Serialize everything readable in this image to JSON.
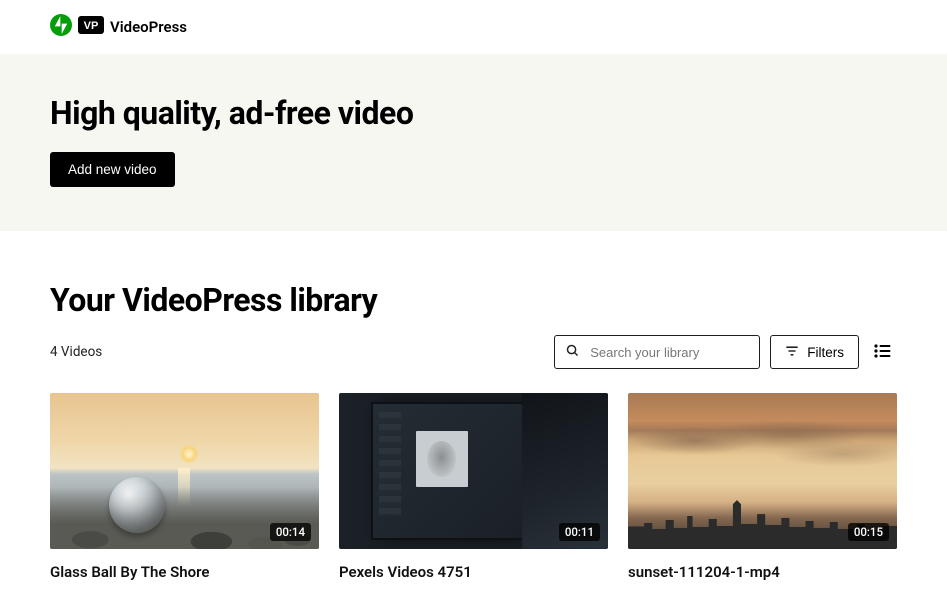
{
  "brand": {
    "name": "VideoPress"
  },
  "hero": {
    "headline": "High quality, ad-free video",
    "add_button": "Add new video"
  },
  "library": {
    "heading": "Your VideoPress library",
    "count_text": "4 Videos",
    "search_placeholder": "Search your library",
    "filters_label": "Filters",
    "videos": [
      {
        "title": "Glass Ball By The Shore",
        "duration": "00:14"
      },
      {
        "title": "Pexels Videos 4751",
        "duration": "00:11"
      },
      {
        "title": "sunset-111204-1-mp4",
        "duration": "00:15"
      }
    ]
  }
}
